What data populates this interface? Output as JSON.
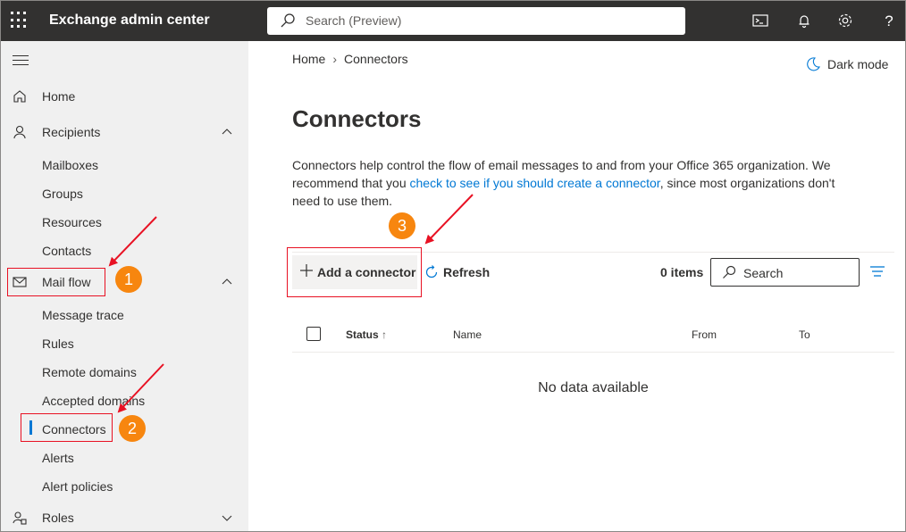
{
  "topbar": {
    "app_title": "Exchange admin center",
    "search_placeholder": "Search (Preview)"
  },
  "sidebar": {
    "home": "Home",
    "recipients": "Recipients",
    "recipients_sub": [
      "Mailboxes",
      "Groups",
      "Resources",
      "Contacts"
    ],
    "mail_flow": "Mail flow",
    "mail_flow_sub": [
      "Message trace",
      "Rules",
      "Remote domains",
      "Accepted domains",
      "Connectors",
      "Alerts",
      "Alert policies"
    ],
    "roles": "Roles",
    "active_item": "Connectors"
  },
  "breadcrumb": {
    "home": "Home",
    "current": "Connectors"
  },
  "dark_mode": "Dark mode",
  "page": {
    "title": "Connectors",
    "desc_before": "Connectors help control the flow of email messages to and from your Office 365 organization. We recommend that you ",
    "desc_link": "check to see if you should create a connector",
    "desc_after": ", since most organizations don't need to use them."
  },
  "toolbar": {
    "add_label": "Add a connector",
    "refresh_label": "Refresh",
    "items_count": "0 items",
    "search_label": "Search"
  },
  "grid": {
    "columns": [
      "Status",
      "Name",
      "From",
      "To"
    ],
    "empty": "No data available"
  },
  "annotations": {
    "badges": [
      "1",
      "2",
      "3"
    ],
    "color_badge": "#f7860f",
    "color_arrow": "#e81123"
  },
  "colors": {
    "accent": "#0078d4",
    "topbar": "#323130",
    "sidebar": "#f0f0f0"
  }
}
